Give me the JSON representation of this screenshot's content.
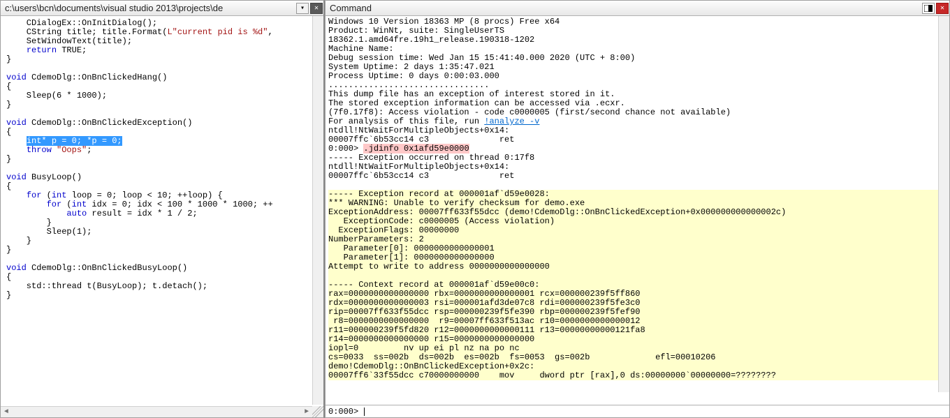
{
  "left": {
    "title": "c:\\users\\bcn\\documents\\visual studio 2013\\projects\\de",
    "code": {
      "l1": "    CDialogEx::OnInitDialog();",
      "l2a": "    CString title; title.Format(",
      "l2b": "L\"current pid is %d\"",
      "l2c": ",",
      "l3": "    SetWindowText(title);",
      "l4a": "    ",
      "l4b": "return",
      "l4c": " TRUE;",
      "l5": "}",
      "l6": "",
      "l7a": "void",
      "l7b": " CdemoDlg::OnBnClickedHang()",
      "l8": "{",
      "l9": "    Sleep(6 * 1000);",
      "l10": "}",
      "l11": "",
      "l12a": "void",
      "l12b": " CdemoDlg::OnBnClickedException()",
      "l13": "{",
      "l14a": "    ",
      "l14b": "int* p = 0; *p = 0;",
      "l15a": "    ",
      "l15b": "throw",
      "l15c": " ",
      "l15d": "\"Oops\"",
      "l15e": ";",
      "l16": "}",
      "l17": "",
      "l18a": "void",
      "l18b": " BusyLoop()",
      "l19": "{",
      "l20a": "    ",
      "l20b": "for",
      "l20c": " (",
      "l20d": "int",
      "l20e": " loop = 0; loop < 10; ++loop) {",
      "l21a": "        ",
      "l21b": "for",
      "l21c": " (",
      "l21d": "int",
      "l21e": " idx = 0; idx < 100 * 1000 * 1000; ++",
      "l22a": "            ",
      "l22b": "auto",
      "l22c": " result = idx * 1 / 2;",
      "l23": "        }",
      "l24": "        Sleep(1);",
      "l25": "    }",
      "l26": "}",
      "l27": "",
      "l28a": "void",
      "l28b": " CdemoDlg::OnBnClickedBusyLoop()",
      "l29": "{",
      "l30": "    std::thread t(BusyLoop); t.detach();",
      "l31": "}"
    }
  },
  "right": {
    "title": "Command",
    "header": [
      "Windows 10 Version 18363 MP (8 procs) Free x64",
      "Product: WinNt, suite: SingleUserTS",
      "18362.1.amd64fre.19h1_release.190318-1202",
      "Machine Name:",
      "Debug session time: Wed Jan 15 15:41:40.000 2020 (UTC + 8:00)",
      "System Uptime: 2 days 1:35:47.021",
      "Process Uptime: 0 days 0:00:03.000",
      "................................",
      "This dump file has an exception of interest stored in it.",
      "The stored exception information can be accessed via .ecxr."
    ],
    "av": "(7f0.17f8): Access violation - code c0000005 (first/second chance not available)",
    "analyze_a": "For analysis of this file, run ",
    "analyze_link": "!analyze -v",
    "nt1": "ntdll!NtWaitForMultipleObjects+0x14:",
    "nt2": "00007ffc`6b53cc14 c3              ret",
    "prompt1": "0:000> ",
    "jd": ".jdinfo 0x1afd59e0000",
    "exc_occ": "----- Exception occurred on thread 0:17f8",
    "nt3": "ntdll!NtWaitForMultipleObjects+0x14:",
    "nt4": "00007ffc`6b53cc14 c3              ret",
    "blank": "",
    "yellow": [
      "----- Exception record at 000001af`d59e0028:",
      "*** WARNING: Unable to verify checksum for demo.exe",
      "ExceptionAddress: 00007ff633f55dcc (demo!CdemoDlg::OnBnClickedException+0x000000000000002c)",
      "   ExceptionCode: c0000005 (Access violation)",
      "  ExceptionFlags: 00000000",
      "NumberParameters: 2",
      "   Parameter[0]: 0000000000000001",
      "   Parameter[1]: 0000000000000000",
      "Attempt to write to address 0000000000000000",
      "",
      "----- Context record at 000001af`d59e00c0:",
      "rax=0000000000000000 rbx=0000000000000001 rcx=000000239f5ff860",
      "rdx=0000000000000003 rsi=000001afd3de07c8 rdi=000000239f5fe3c0",
      "rip=00007ff633f55dcc rsp=000000239f5fe390 rbp=000000239f5fef90",
      " r8=0000000000000000  r9=00007ff633f513ac r10=0000000000000012",
      "r11=000000239f5fd820 r12=0000000000000111 r13=00000000000121fa8",
      "r14=0000000000000000 r15=0000000000000000",
      "iopl=0         nv up ei pl nz na po nc",
      "cs=0033  ss=002b  ds=002b  es=002b  fs=0053  gs=002b             efl=00010206",
      "demo!CdemoDlg::OnBnClickedException+0x2c:",
      "00007ff6`33f55dcc c70000000000    mov     dword ptr [rax],0 ds:00000000`00000000=????????"
    ],
    "prompt_label": "0:000>",
    "prompt_value": ""
  }
}
